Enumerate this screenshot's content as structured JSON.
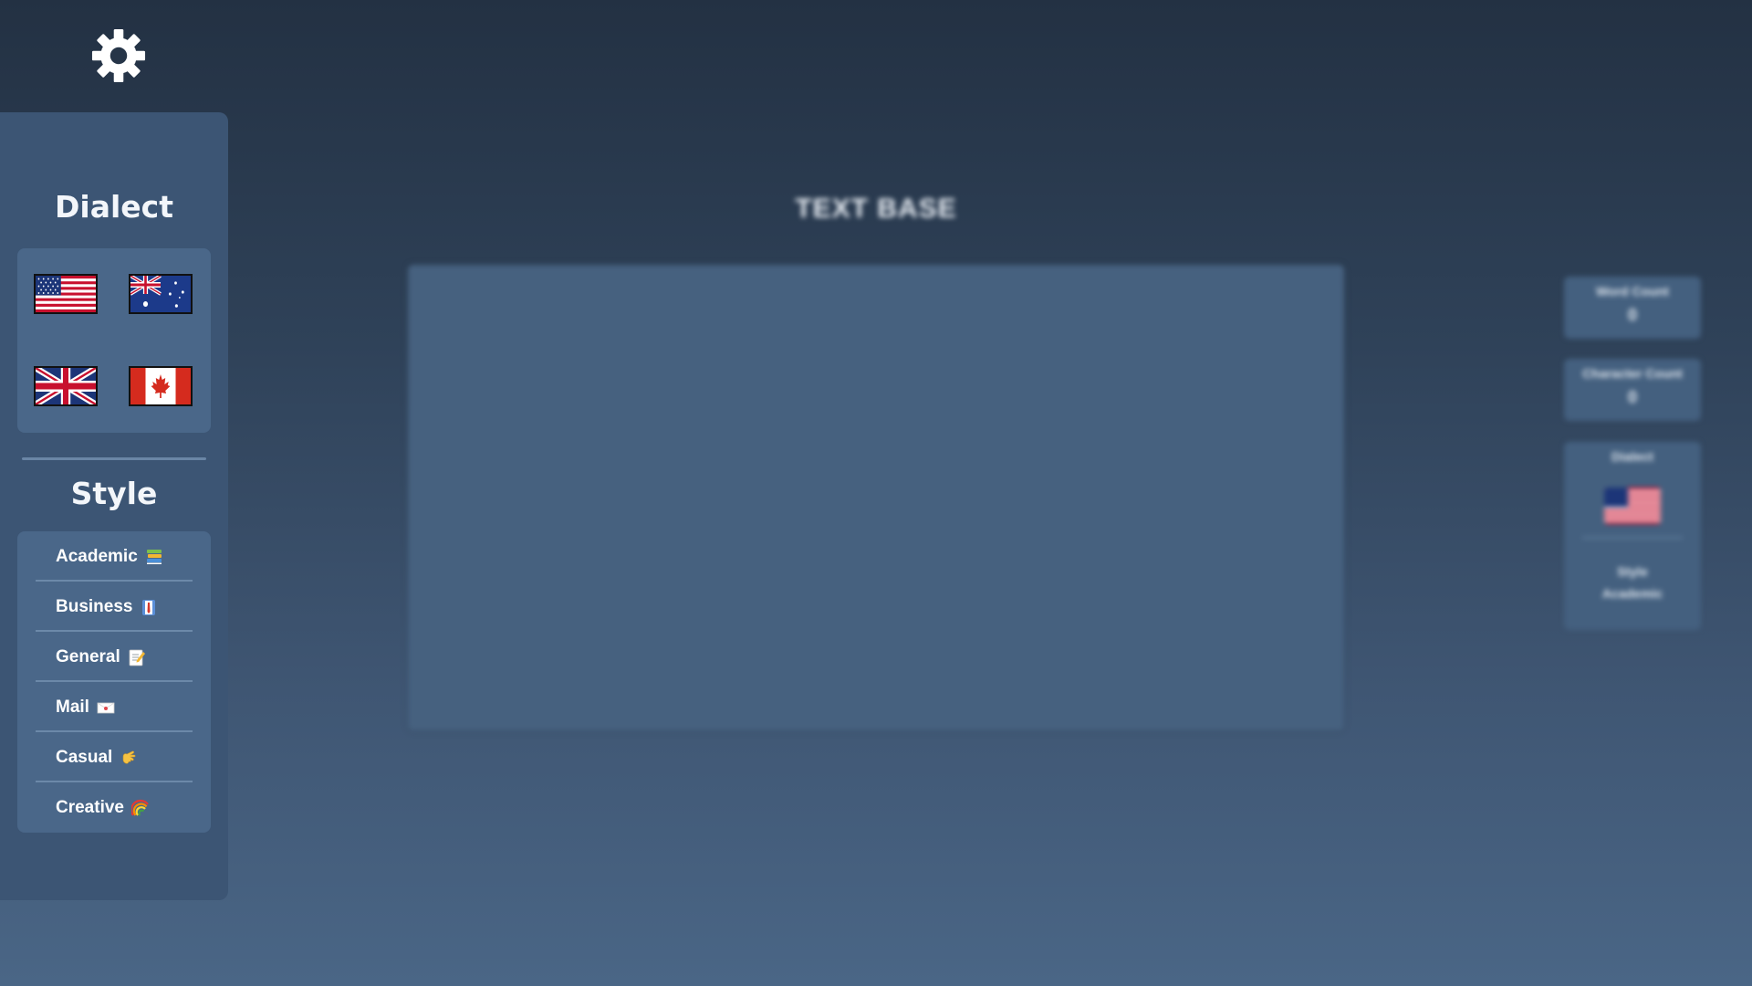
{
  "sidebar": {
    "dialect_title": "Dialect",
    "style_title": "Style",
    "flags": [
      {
        "name": "US"
      },
      {
        "name": "Australia"
      },
      {
        "name": "UK"
      },
      {
        "name": "Canada"
      }
    ],
    "styles": [
      {
        "label": "Academic",
        "icon": "books-icon"
      },
      {
        "label": "Business",
        "icon": "briefcase-icon"
      },
      {
        "label": "General",
        "icon": "memo-icon"
      },
      {
        "label": "Mail",
        "icon": "envelope-icon"
      },
      {
        "label": "Casual",
        "icon": "hand-icon"
      },
      {
        "label": "Creative",
        "icon": "rainbow-icon"
      }
    ]
  },
  "main": {
    "title": "TEXT BASE",
    "text_value": ""
  },
  "stats": {
    "word_count_label": "Word Count",
    "word_count_value": "0",
    "char_count_label": "Character Count",
    "char_count_value": "0",
    "dialect_label": "Dialect",
    "style_label": "Style",
    "style_value": "Academic"
  },
  "colors": {
    "sidebar_bg": "#3c5574",
    "panel_bg": "#4a6789",
    "text_area_bg": "#46617f"
  }
}
